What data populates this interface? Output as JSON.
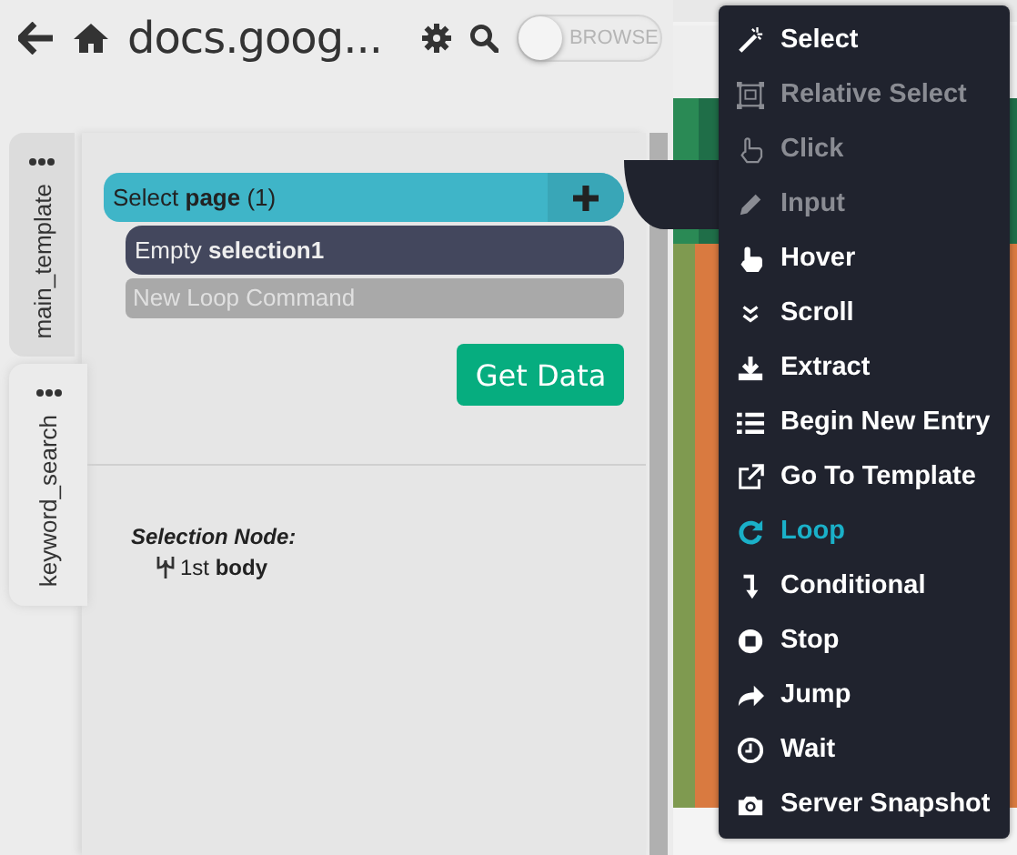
{
  "header": {
    "title": "docs.goog...",
    "toggle": {
      "label": "BROWSE",
      "on": false
    }
  },
  "template_tabs": [
    {
      "label": "main_template",
      "selected": false
    },
    {
      "label": "keyword_search",
      "selected": true
    }
  ],
  "commands": [
    {
      "kind": "select",
      "text": "Select **page** (1)"
    },
    {
      "kind": "empty",
      "text": "Empty **selection1**"
    },
    {
      "kind": "new",
      "text": "New Loop Command"
    }
  ],
  "get_data_button": "Get Data",
  "selection_node": {
    "title": "Selection Node:",
    "path": "1st **body**"
  },
  "menu": [
    {
      "label": "Select",
      "disabled": false,
      "selected": false
    },
    {
      "label": "Relative Select",
      "disabled": true,
      "selected": false
    },
    {
      "label": "Click",
      "disabled": true,
      "selected": false
    },
    {
      "label": "Input",
      "disabled": true,
      "selected": false
    },
    {
      "label": "Hover",
      "disabled": false,
      "selected": false
    },
    {
      "label": "Scroll",
      "disabled": false,
      "selected": false
    },
    {
      "label": "Extract",
      "disabled": false,
      "selected": false
    },
    {
      "label": "Begin New Entry",
      "disabled": false,
      "selected": false
    },
    {
      "label": "Go To Template",
      "disabled": false,
      "selected": false
    },
    {
      "label": "Loop",
      "disabled": false,
      "selected": true
    },
    {
      "label": "Conditional",
      "disabled": false,
      "selected": false
    },
    {
      "label": "Stop",
      "disabled": false,
      "selected": false
    },
    {
      "label": "Jump",
      "disabled": false,
      "selected": false
    },
    {
      "label": "Wait",
      "disabled": false,
      "selected": false
    },
    {
      "label": "Server Snapshot",
      "disabled": false,
      "selected": false
    }
  ]
}
